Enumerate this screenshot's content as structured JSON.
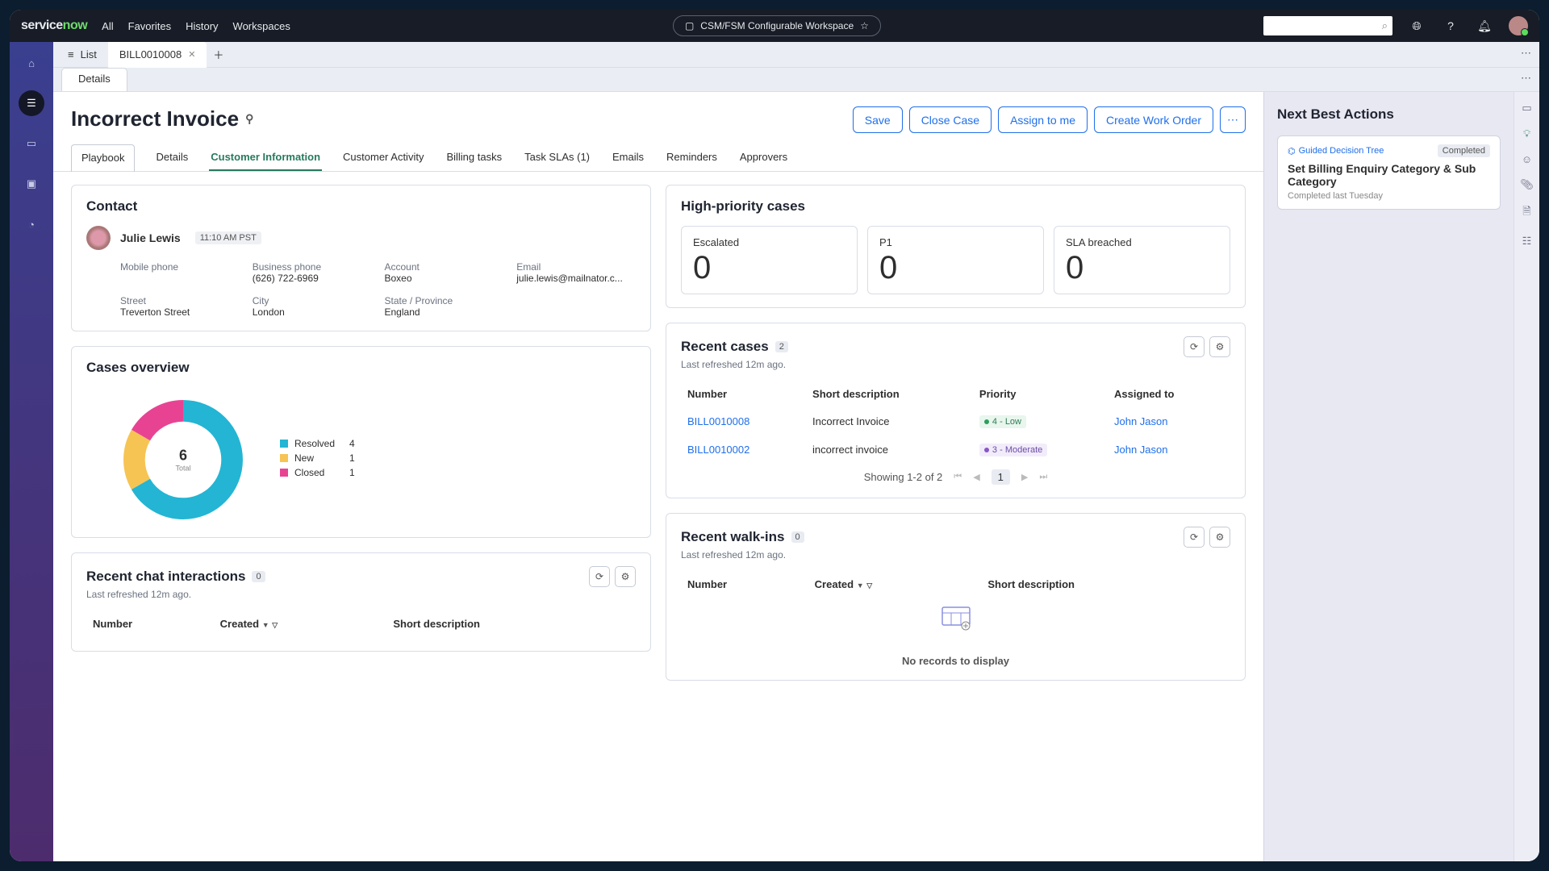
{
  "top": {
    "logo_part1": "service",
    "logo_part2": "now",
    "nav": [
      "All",
      "Favorites",
      "History",
      "Workspaces"
    ],
    "workspace_label": "CSM/FSM Configurable Workspace"
  },
  "wtabs": {
    "list": "List",
    "record": "BILL0010008"
  },
  "sub_tab": "Details",
  "record": {
    "title": "Incorrect Invoice",
    "buttons": [
      "Save",
      "Close Case",
      "Assign to me",
      "Create Work Order"
    ],
    "tabs": [
      "Playbook",
      "Details",
      "Customer Information",
      "Customer Activity",
      "Billing tasks",
      "Task SLAs (1)",
      "Emails",
      "Reminders",
      "Approvers"
    ],
    "active_tab_index": 2
  },
  "contact": {
    "title": "Contact",
    "name": "Julie Lewis",
    "time": "11:10 AM PST",
    "fields": [
      {
        "label": "Mobile phone",
        "value": ""
      },
      {
        "label": "Business phone",
        "value": "(626) 722-6969"
      },
      {
        "label": "Account",
        "value": "Boxeo"
      },
      {
        "label": "Email",
        "value": "julie.lewis@mailnator.c..."
      },
      {
        "label": "Street",
        "value": "Treverton Street"
      },
      {
        "label": "City",
        "value": "London"
      },
      {
        "label": "State / Province",
        "value": "England"
      }
    ]
  },
  "hp": {
    "title": "High-priority cases",
    "items": [
      {
        "label": "Escalated",
        "value": "0"
      },
      {
        "label": "P1",
        "value": "0"
      },
      {
        "label": "SLA breached",
        "value": "0"
      }
    ]
  },
  "overview": {
    "title": "Cases overview",
    "center_num": "6",
    "center_label": "Total",
    "legend": [
      {
        "label": "Resolved",
        "value": "4",
        "color": "#23b5d3"
      },
      {
        "label": "New",
        "value": "1",
        "color": "#f6c453"
      },
      {
        "label": "Closed",
        "value": "1",
        "color": "#e84393"
      }
    ]
  },
  "chart_data": {
    "type": "pie",
    "title": "Cases overview",
    "categories": [
      "Resolved",
      "New",
      "Closed"
    ],
    "values": [
      4,
      1,
      1
    ],
    "colors": [
      "#23b5d3",
      "#f6c453",
      "#e84393"
    ],
    "total_label": "Total",
    "total": 6
  },
  "recent_cases": {
    "title": "Recent cases",
    "count": "2",
    "sub": "Last refreshed 12m ago.",
    "headers": [
      "Number",
      "Short description",
      "Priority",
      "Assigned to"
    ],
    "rows": [
      {
        "num": "BILL0010008",
        "desc": "Incorrect Invoice",
        "pri_label": "4 - Low",
        "pri_class": "pri-low",
        "dot": "#2f9e5d",
        "assigned": "John Jason"
      },
      {
        "num": "BILL0010002",
        "desc": "incorrect invoice",
        "pri_label": "3 - Moderate",
        "pri_class": "pri-mod",
        "dot": "#8856c7",
        "assigned": "John Jason"
      }
    ],
    "pager_text": "Showing 1-2 of 2",
    "pager_cur": "1"
  },
  "walk_ins": {
    "title": "Recent walk-ins",
    "count": "0",
    "sub": "Last refreshed 12m ago.",
    "headers": [
      "Number",
      "Created",
      "Short description"
    ],
    "empty": "No records to display"
  },
  "chat": {
    "title": "Recent chat interactions",
    "count": "0",
    "sub": "Last refreshed 12m ago.",
    "headers": [
      "Number",
      "Created",
      "Short description"
    ]
  },
  "nba": {
    "title": "Next Best Actions",
    "guided_label": "Guided Decision Tree",
    "status": "Completed",
    "card_title": "Set Billing Enquiry Category & Sub Category",
    "card_sub": "Completed last Tuesday"
  }
}
